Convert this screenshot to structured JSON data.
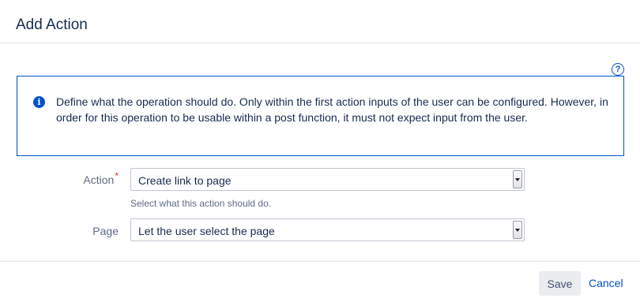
{
  "dialog": {
    "title": "Add Action"
  },
  "info": {
    "text": "Define what the operation should do. Only within the first action inputs of the user can be configured. However, in order for this operation to be usable within a post function, it must not expect input from the user."
  },
  "form": {
    "action": {
      "label": "Action",
      "required_marker": "*",
      "value": "Create link to page",
      "help": "Select what this action should do."
    },
    "page": {
      "label": "Page",
      "value": "Let the user select the page"
    }
  },
  "footer": {
    "save_label": "Save",
    "cancel_label": "Cancel"
  },
  "colors": {
    "accent": "#0052cc",
    "required": "#de350b",
    "text": "#172b4d",
    "muted": "#5e6c84"
  },
  "icons": {
    "help": "question-circle-icon",
    "info": "info-circle-icon",
    "dropdown": "chevron-down-icon"
  }
}
